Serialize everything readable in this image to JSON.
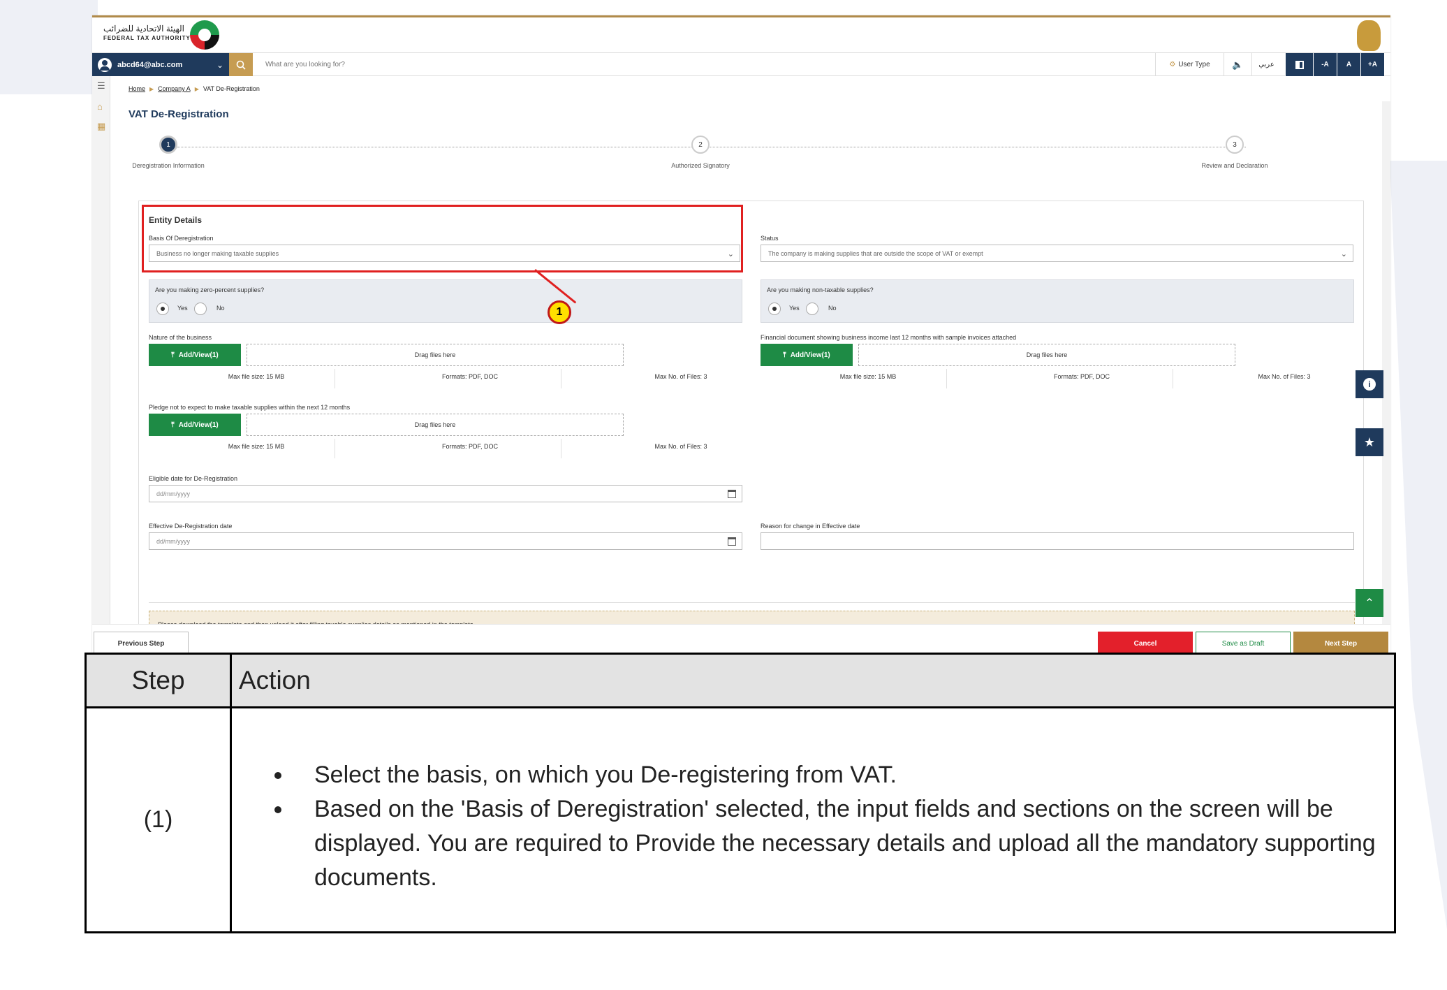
{
  "header": {
    "logo_ar": "الهيئة الاتحادية للضرائب",
    "logo_en": "FEDERAL TAX AUTHORITY",
    "user_email": "abcd64@abc.com",
    "search_placeholder": "What are you looking for?",
    "user_type_label": "User Type",
    "arabic_label": "عربي",
    "font_minus": "-A",
    "font_normal": "A",
    "font_plus": "+A"
  },
  "breadcrumb": [
    "Home",
    "Company A",
    "VAT De-Registration"
  ],
  "page_title": "VAT De-Registration",
  "stepper": [
    {
      "num": "1",
      "label": "Deregistration Information"
    },
    {
      "num": "2",
      "label": "Authorized Signatory"
    },
    {
      "num": "3",
      "label": "Review and Declaration"
    }
  ],
  "entity": {
    "section_title": "Entity Details",
    "basis_label": "Basis Of Deregistration",
    "basis_value": "Business no longer making taxable supplies",
    "status_label": "Status",
    "status_value": "The company is making supplies that are outside the scope of VAT or exempt",
    "zero_q": "Are you making zero-percent supplies?",
    "nontax_q": "Are you making non-taxable supplies?",
    "yes": "Yes",
    "no": "No",
    "nature_label": "Nature of the business",
    "financial_label": "Financial document showing business income last 12 months with sample invoices attached",
    "pledge_label": "Pledge not to expect to make taxable supplies within the next 12 months",
    "add_view": "Add/View(1)",
    "drag": "Drag files here",
    "max_size": "Max file size: 15 MB",
    "formats": "Formats: PDF, DOC",
    "max_files": "Max No. of Files: 3",
    "eligible_label": "Eligible date for De-Registration",
    "date_placeholder": "dd/mm/yyyy",
    "effective_label": "Effective De-Registration date",
    "reason_label": "Reason for change in Effective date",
    "info_text": "Please download the template and then upload it after filling taxable supplies details as mentioned in the template"
  },
  "callout_number": "1",
  "footer": {
    "previous": "Previous Step",
    "cancel": "Cancel",
    "draft": "Save as Draft",
    "next": "Next Step"
  },
  "table": {
    "col_step": "Step",
    "col_action": "Action",
    "row_step": "(1)",
    "bullets": [
      "Select the basis, on which you De-registering from VAT.",
      " Based on the 'Basis of Deregistration' selected, the input fields and sections on the screen will be displayed. You are required to Provide the necessary details and upload all the mandatory supporting documents."
    ]
  },
  "colors": {
    "navy": "#1f3a5c",
    "gold": "#c69c52",
    "green": "#1e8b45",
    "red": "#e02020",
    "cancel_red": "#e3202b",
    "next_gold": "#b4883f"
  }
}
